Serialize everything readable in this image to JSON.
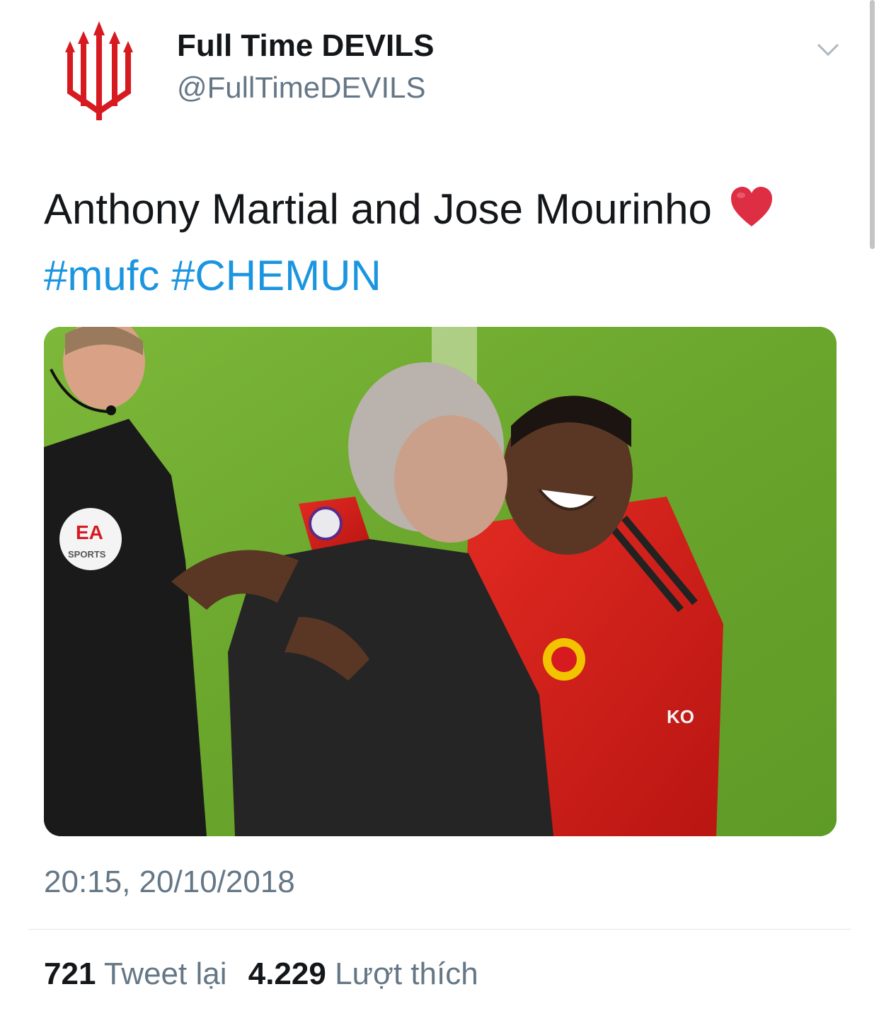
{
  "author": {
    "display_name": "Full Time DEVILS",
    "handle": "@FullTimeDEVILS",
    "avatar_icon": "trident-logo-icon",
    "brand_color": "#d71920"
  },
  "tweet": {
    "text": "Anthony Martial and Jose Mourinho",
    "emoji_icon": "red-heart-icon",
    "hashtags": [
      "#mufc",
      "#CHEMUN"
    ],
    "hashtag_color": "#1b95e0",
    "timestamp": "20:15, 20/10/2018"
  },
  "media": {
    "kit_texts": [
      "EA",
      "SPORTS",
      "KO"
    ]
  },
  "stats": {
    "retweets_count": "721",
    "retweets_label": "Tweet lại",
    "likes_count": "4.229",
    "likes_label": "Lượt thích"
  },
  "icons": {
    "menu": "chevron-down-icon"
  }
}
